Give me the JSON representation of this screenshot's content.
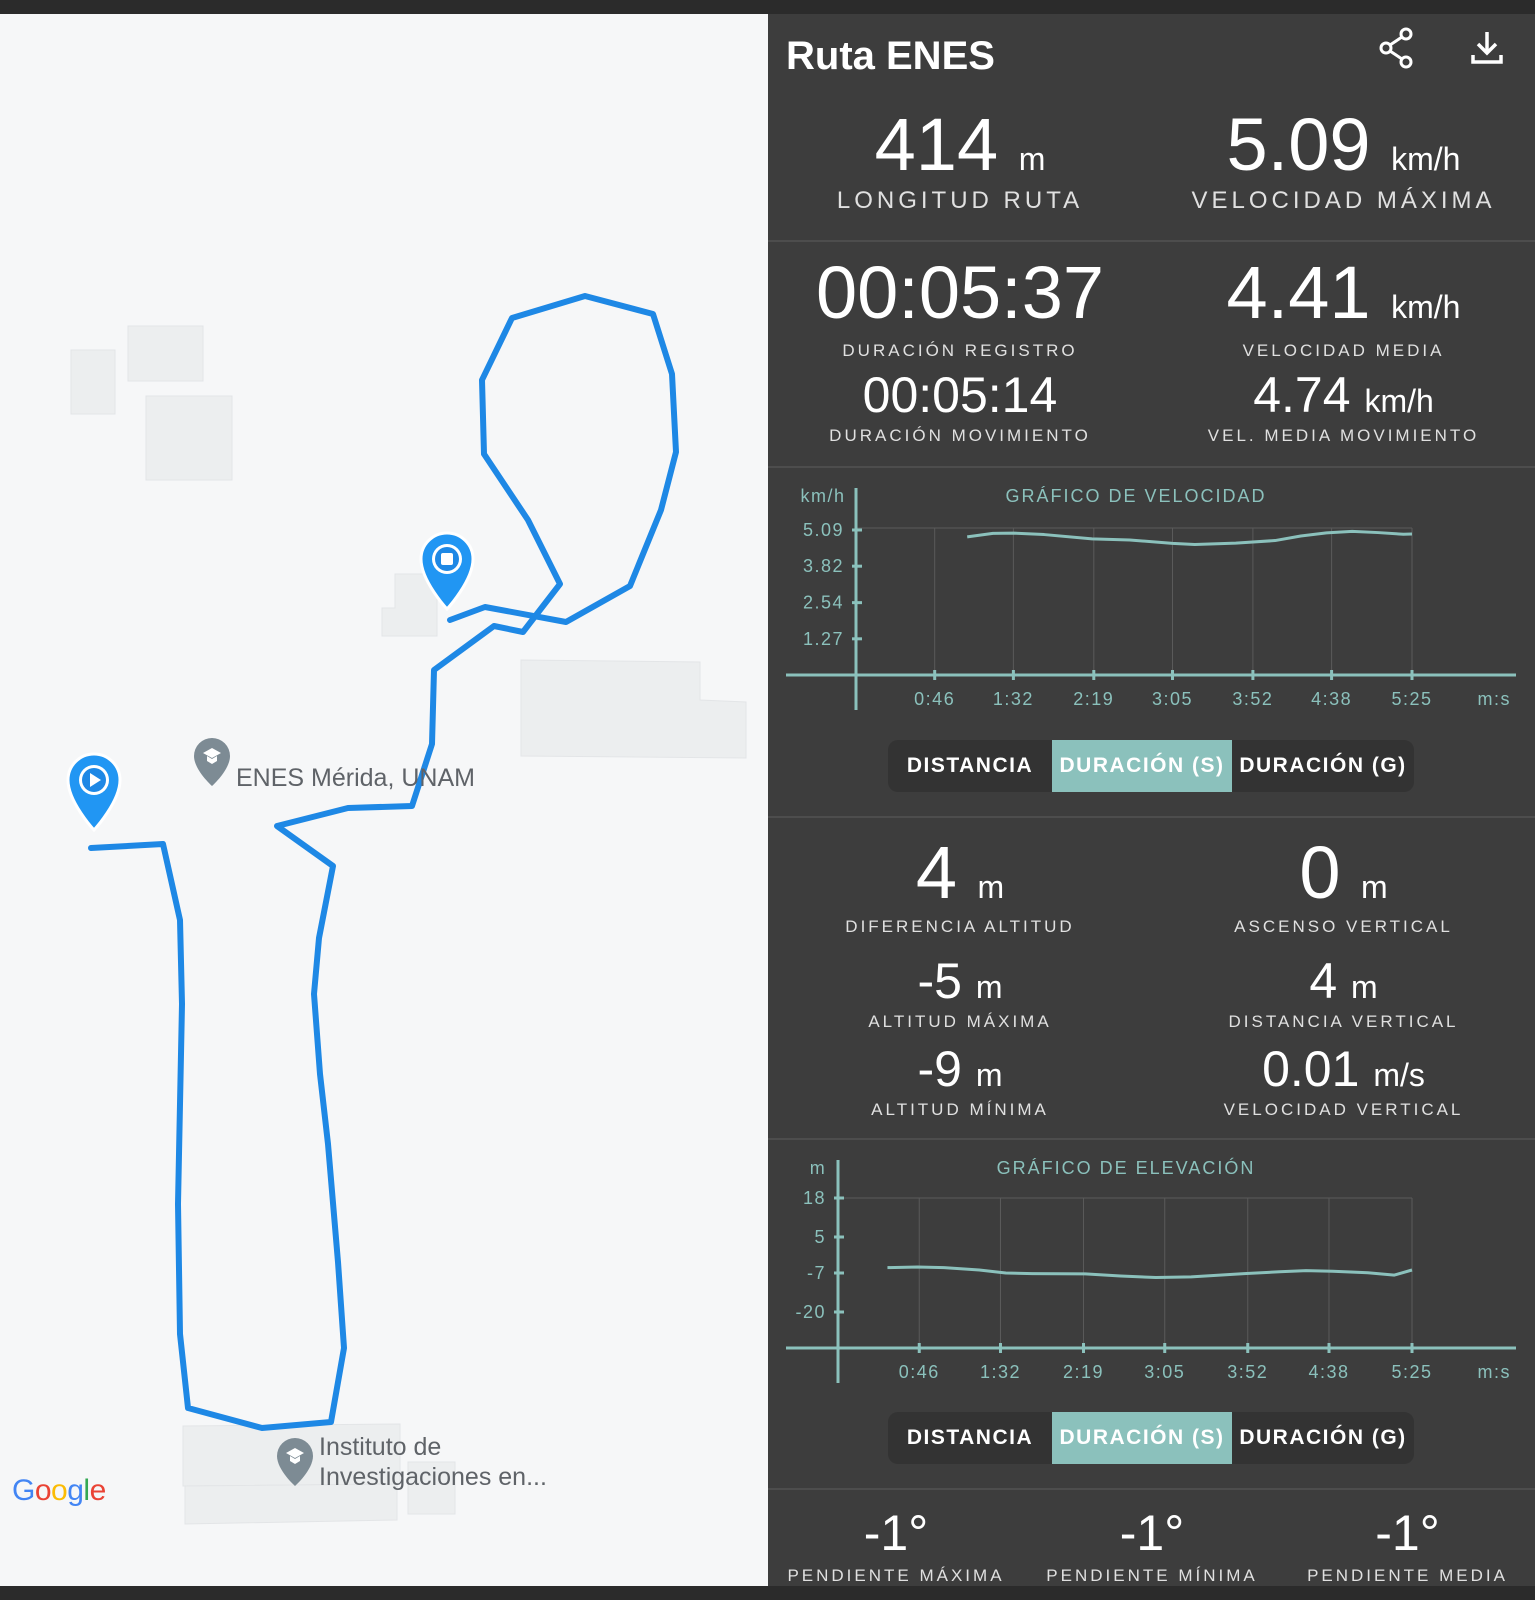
{
  "map": {
    "place_1": "ENES Mérida, UNAM",
    "place_2_line1": "Instituto de",
    "place_2_line2": "Investigaciones en...",
    "logo": "Google",
    "route_color": "#1e88e5"
  },
  "header": {
    "title": "Ruta ENES",
    "share_icon": "share-icon",
    "download_icon": "download-icon"
  },
  "summary": {
    "route_length": {
      "value": "414",
      "unit": "m",
      "label": "LONGITUD RUTA"
    },
    "max_speed": {
      "value": "5.09",
      "unit": "km/h",
      "label": "VELOCIDAD MÁXIMA"
    },
    "record_duration": {
      "value": "00:05:37",
      "label": "DURACIÓN REGISTRO"
    },
    "avg_speed": {
      "value": "4.41",
      "unit": "km/h",
      "label": "VELOCIDAD MEDIA"
    },
    "moving_duration": {
      "value": "00:05:14",
      "label": "DURACIÓN MOVIMIENTO"
    },
    "moving_avg_speed": {
      "value": "4.74",
      "unit": "km/h",
      "label": "VEL. MEDIA MOVIMIENTO"
    }
  },
  "elevation_stats": {
    "altitude_diff": {
      "value": "4",
      "unit": "m",
      "label": "DIFERENCIA ALTITUD"
    },
    "vertical_ascent": {
      "value": "0",
      "unit": "m",
      "label": "ASCENSO VERTICAL"
    },
    "max_altitude": {
      "value": "-5",
      "unit": "m",
      "label": "ALTITUD MÁXIMA"
    },
    "vertical_distance": {
      "value": "4",
      "unit": "m",
      "label": "DISTANCIA VERTICAL"
    },
    "min_altitude": {
      "value": "-9",
      "unit": "m",
      "label": "ALTITUD MÍNIMA"
    },
    "vertical_speed": {
      "value": "0.01",
      "unit": "m/s",
      "label": "VELOCIDAD VERTICAL"
    }
  },
  "slopes": {
    "max": {
      "value": "-1°",
      "label": "PENDIENTE MÁXIMA"
    },
    "min": {
      "value": "-1°",
      "label": "PENDIENTE MÍNIMA"
    },
    "avg": {
      "value": "-1°",
      "label": "PENDIENTE MEDIA"
    }
  },
  "toggle": {
    "options": [
      "DISTANCIA",
      "DURACIÓN (S)",
      "DURACIÓN (G)"
    ],
    "active_index": 1
  },
  "colors": {
    "accent": "#8bc1bc",
    "panel_bg": "#3d3d3d",
    "chart_line": "#8bc1bc"
  },
  "chart_data": [
    {
      "type": "line",
      "title": "GRÁFICO DE VELOCIDAD",
      "ylabel": "km/h",
      "xlabel": "m:s",
      "yticks": [
        "1.27",
        "2.54",
        "3.82",
        "5.09"
      ],
      "xticks": [
        "0:46",
        "1:32",
        "2:19",
        "3:05",
        "3:52",
        "4:38",
        "5:25"
      ],
      "ylim": [
        0,
        5.09
      ],
      "x": [
        65,
        80,
        92,
        110,
        138,
        160,
        185,
        198,
        222,
        245,
        260,
        275,
        290,
        305,
        320,
        325
      ],
      "y": [
        4.85,
        4.97,
        4.98,
        4.93,
        4.78,
        4.74,
        4.62,
        4.58,
        4.63,
        4.72,
        4.88,
        4.99,
        5.04,
        5.0,
        4.94,
        4.95
      ],
      "series": [
        {
          "name": "",
          "color": "#8bc1bc"
        }
      ]
    },
    {
      "type": "line",
      "title": "GRÁFICO DE ELEVACIÓN",
      "ylabel": "m",
      "xlabel": "m:s",
      "yticks": [
        "-20",
        "-7",
        "5",
        "18"
      ],
      "xticks": [
        "0:46",
        "1:32",
        "2:19",
        "3:05",
        "3:52",
        "4:38",
        "5:25"
      ],
      "ylim": [
        -32,
        18
      ],
      "x": [
        28,
        45,
        60,
        80,
        95,
        110,
        140,
        160,
        180,
        200,
        230,
        250,
        265,
        280,
        300,
        315,
        325
      ],
      "y": [
        -5.2,
        -5.0,
        -5.2,
        -6.0,
        -7.0,
        -7.2,
        -7.3,
        -8.0,
        -8.5,
        -8.3,
        -7.2,
        -6.6,
        -6.2,
        -6.4,
        -6.9,
        -7.7,
        -6.0
      ],
      "series": [
        {
          "name": "",
          "color": "#8bc1bc"
        }
      ]
    }
  ]
}
